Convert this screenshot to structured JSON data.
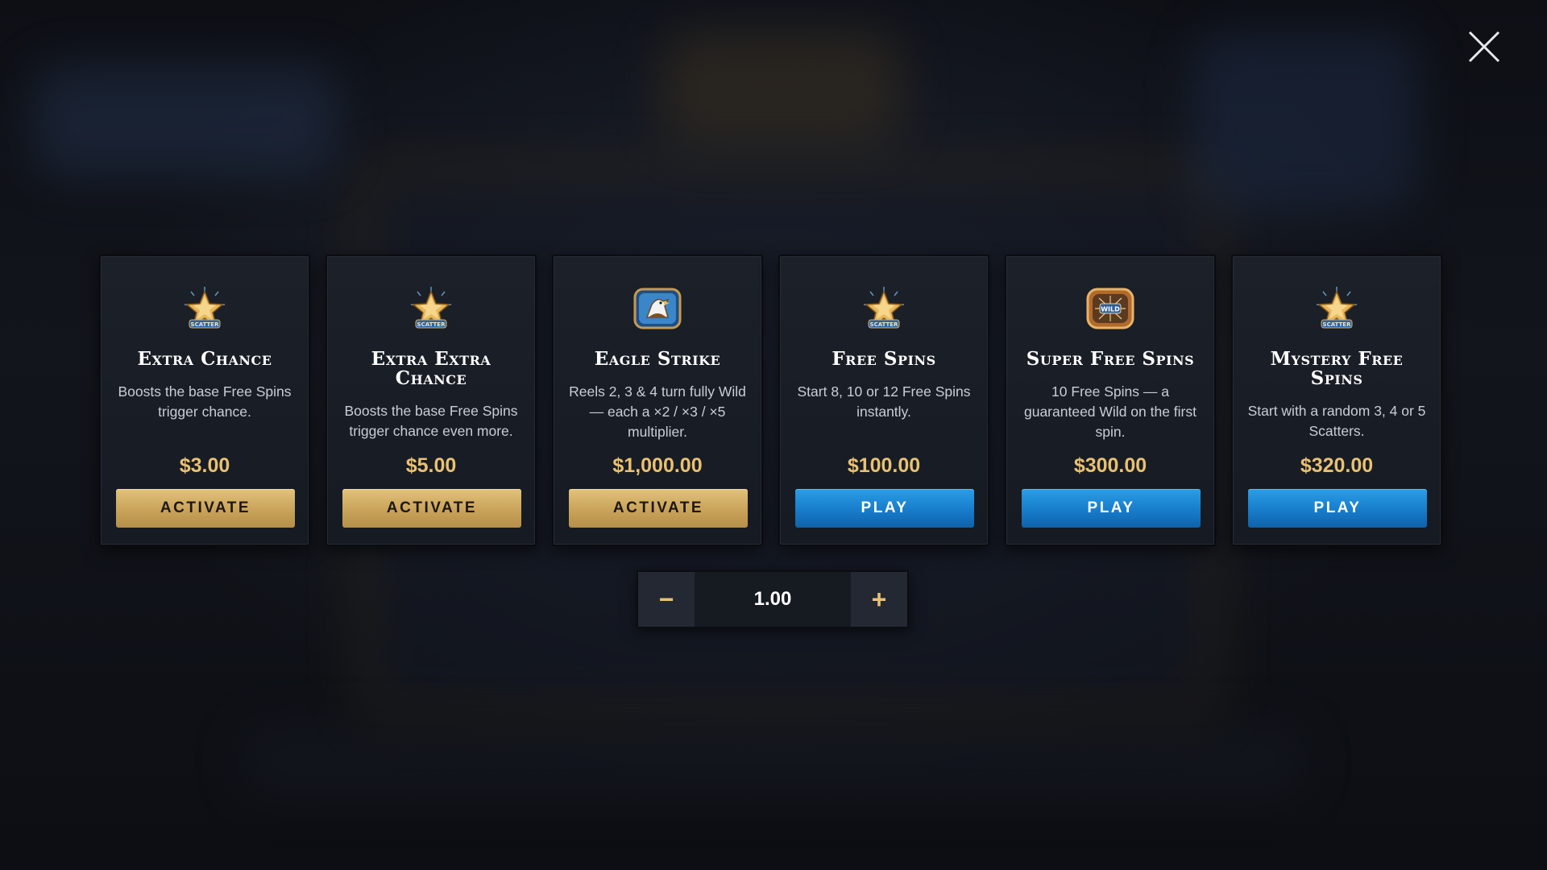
{
  "close": {
    "icon": "close-icon"
  },
  "cards": [
    {
      "title": "Extra Chance",
      "description": "Boosts the base Free Spins trigger chance.",
      "price": "$3.00",
      "button": "ACTIVATE",
      "button_style": "gold",
      "icon": "scatter-star-icon"
    },
    {
      "title": "Extra Extra Chance",
      "description": "Boosts the base Free Spins trigger chance even more.",
      "price": "$5.00",
      "button": "ACTIVATE",
      "button_style": "gold",
      "icon": "scatter-star-icon"
    },
    {
      "title": "Eagle Strike",
      "description": "Reels 2, 3 & 4 turn fully Wild — each a ×2 / ×3 / ×5 multiplier.",
      "price": "$1,000.00",
      "button": "ACTIVATE",
      "button_style": "gold",
      "icon": "eagle-icon"
    },
    {
      "title": "Free Spins",
      "description": "Start 8, 10 or 12 Free Spins instantly.",
      "price": "$100.00",
      "button": "PLAY",
      "button_style": "blue",
      "icon": "scatter-star-icon"
    },
    {
      "title": "Super Free Spins",
      "description": "10 Free Spins — a guaranteed Wild on the first spin.",
      "price": "$300.00",
      "button": "PLAY",
      "button_style": "blue",
      "icon": "wild-badge-icon"
    },
    {
      "title": "Mystery Free Spins",
      "description": "Start with a random 3, 4 or 5 Scatters.",
      "price": "$320.00",
      "button": "PLAY",
      "button_style": "blue",
      "icon": "scatter-star-icon"
    }
  ],
  "bet_stepper": {
    "minus": "−",
    "value": "1.00",
    "plus": "+"
  },
  "colors": {
    "gold_price": "#e9c171",
    "gold_button": "#d2ad64",
    "blue_button": "#1a82d0",
    "card_bg": "#1a1e27"
  }
}
